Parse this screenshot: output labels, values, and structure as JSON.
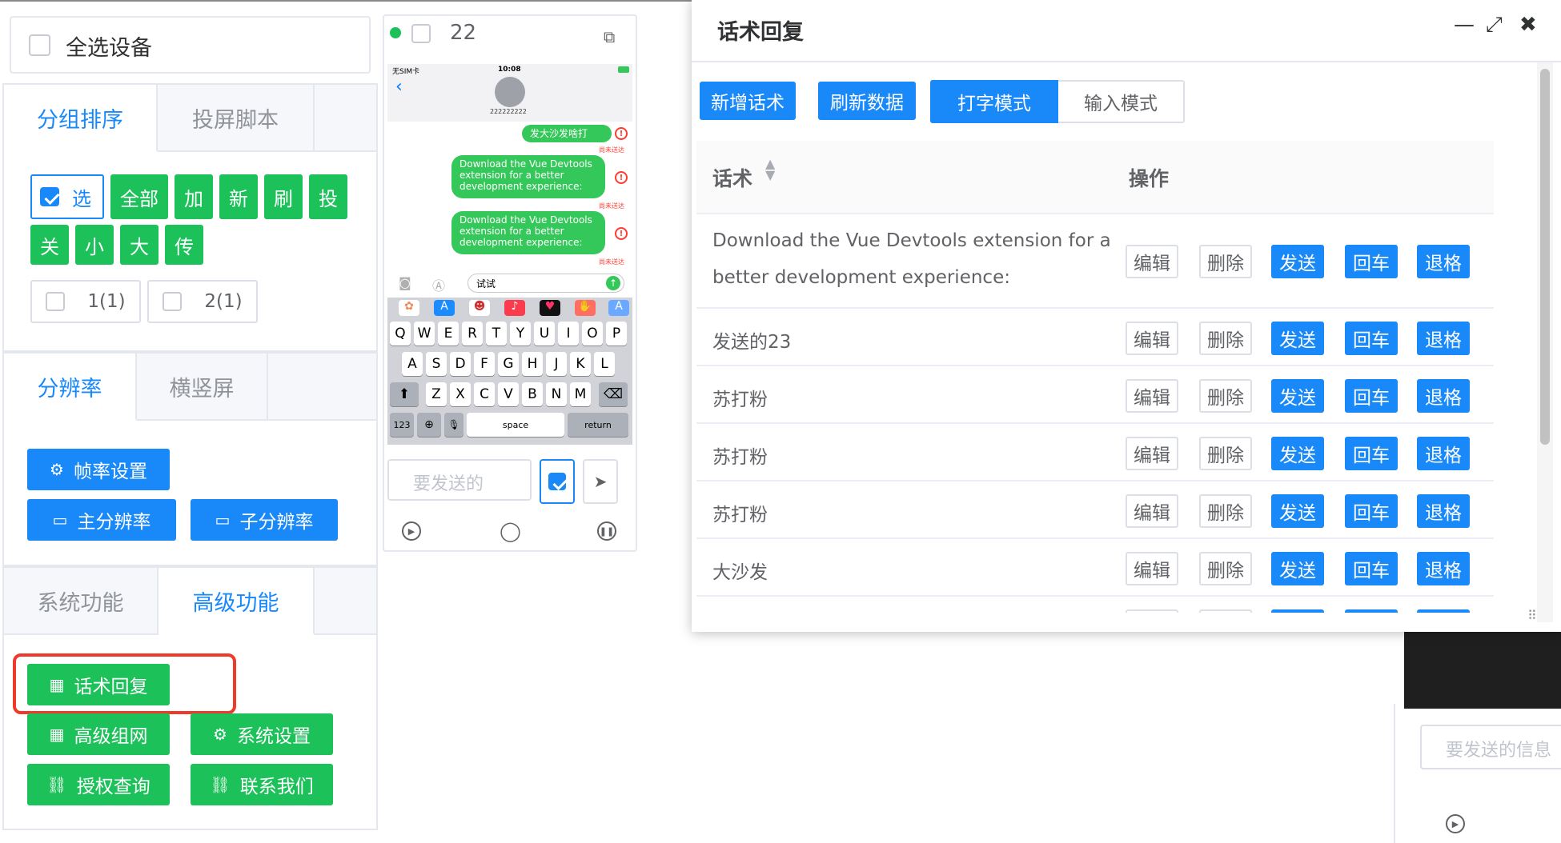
{
  "select_all": {
    "label": "全选设备"
  },
  "group_tabs": [
    {
      "label": "分组排序"
    },
    {
      "label": "投屏脚本"
    }
  ],
  "group_buttons": {
    "select": "选",
    "items": [
      "全部",
      "加",
      "新",
      "刷",
      "投",
      "关",
      "小",
      "大",
      "传"
    ],
    "group_1": "1(1)",
    "group_2": "2(1)"
  },
  "res_tabs": [
    {
      "label": "分辨率"
    },
    {
      "label": "横竖屏"
    }
  ],
  "res_buttons": {
    "fps": "帧率设置",
    "main_res": "主分辨率",
    "sub_res": "子分辨率"
  },
  "func_tabs": [
    {
      "label": "系统功能"
    },
    {
      "label": "高级功能"
    }
  ],
  "func_buttons": {
    "script_reply": "话术回复",
    "adv_network": "高级组网",
    "system_settings": "系统设置",
    "auth_query": "授权查询",
    "contact_us": "联系我们"
  },
  "phone": {
    "device_number": "22",
    "carrier": "无SIM卡",
    "time": "10:08",
    "contact_number": "222222222",
    "messages": [
      "发大沙发啥打",
      "Download the Vue Devtools extension for a better development experience:",
      "Download the Vue Devtools extension for a better development experience:"
    ],
    "unsent_label": "尚未送达",
    "input_text": "试试",
    "keys_row1": [
      "Q",
      "W",
      "E",
      "R",
      "T",
      "Y",
      "U",
      "I",
      "O",
      "P"
    ],
    "keys_row2": [
      "A",
      "S",
      "D",
      "F",
      "G",
      "H",
      "J",
      "K",
      "L"
    ],
    "keys_row3": [
      "Z",
      "X",
      "C",
      "V",
      "B",
      "N",
      "M"
    ],
    "key_123": "123",
    "key_space": "space",
    "key_return": "return",
    "send_placeholder": "要发送的"
  },
  "dialog": {
    "title": "话术回复",
    "toolbar": {
      "add": "新增话术",
      "refresh": "刷新数据",
      "type_mode": "打字模式",
      "input_mode": "输入模式"
    },
    "columns": {
      "script": "话术",
      "action": "操作"
    },
    "rows": [
      {
        "text_line1": "Download the Vue Devtools extension for a",
        "text_line2": "better development experience:"
      },
      {
        "text": "发送的23"
      },
      {
        "text": "苏打粉"
      },
      {
        "text": "苏打粉"
      },
      {
        "text": "苏打粉"
      },
      {
        "text": "大沙发"
      }
    ],
    "row_actions": {
      "edit": "编辑",
      "delete": "删除",
      "send": "发送",
      "enter": "回车",
      "backspace": "退格"
    }
  },
  "background_panel": {
    "send_placeholder": "要发送的信息"
  },
  "colors": {
    "primary": "#1989fa",
    "success": "#1dc15a",
    "highlight": "#ee3a2b"
  }
}
